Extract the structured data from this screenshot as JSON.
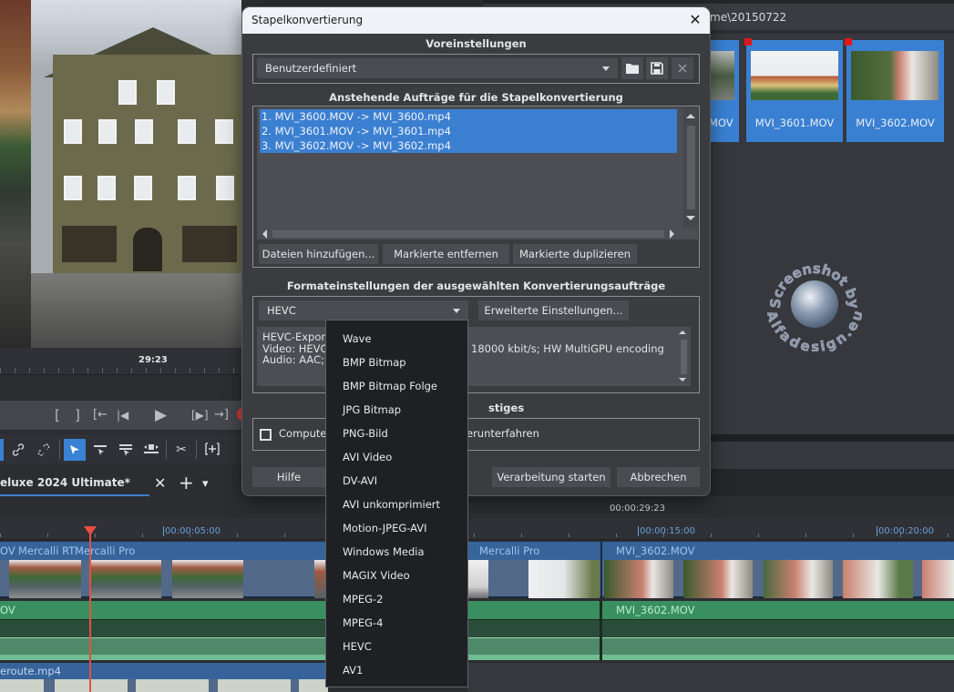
{
  "dialog": {
    "title": "Stapelkonvertierung",
    "sections": {
      "presets": "Voreinstellungen",
      "pending_jobs": "Anstehende Aufträge für die Stapelkonvertierung",
      "format_settings": "Formateinstellungen der ausgewählten Konvertierungsaufträge",
      "misc": "stiges"
    },
    "preset_value": "Benutzerdefiniert",
    "jobs": [
      "1. MVI_3600.MOV -> MVI_3600.mp4",
      "2. MVI_3601.MOV -> MVI_3601.mp4",
      "3. MVI_3602.MOV -> MVI_3602.mp4"
    ],
    "buttons": {
      "add_files": "Dateien hinzufügen...",
      "remove_marked": "Markierte entfernen",
      "duplicate_marked": "Markierte duplizieren",
      "advanced_settings": "Erweiterte Einstellungen...",
      "help": "Hilfe",
      "start": "Verarbeitung starten",
      "cancel": "Abbrechen"
    },
    "format_value": "HEVC",
    "info_lines": {
      "line1_left": "HEVC-Export",
      "line2_left": "Video: HEVC;",
      "line2_right": "18000 kbit/s; HW MultiGPU encoding",
      "line3_left": "Audio: AAC; S"
    },
    "shutdown_label_left": "Computer",
    "shutdown_label_right": "erunterfahren",
    "shutdown_checked": false,
    "format_options": [
      "Wave",
      "BMP Bitmap",
      "BMP Bitmap Folge",
      "JPG Bitmap",
      "PNG-Bild",
      "AVI Video",
      "DV-AVI",
      "AVI unkomprimiert",
      "Motion-JPEG-AVI",
      "Windows Media",
      "MAGIX Video",
      "MPEG-2",
      "MPEG-4",
      "HEVC",
      "AV1"
    ],
    "close_glyph": "✕"
  },
  "preview": {
    "timecode": "29:23"
  },
  "transport": {
    "mark_in": "[",
    "mark_out": "]",
    "goto_in": "[←",
    "prev": "|◀",
    "play": "▶",
    "goto_marker": "[▶]",
    "goto_out": "→]"
  },
  "project": {
    "tab_label": "eluxe 2024 Ultimate*",
    "close_glyph": "✕",
    "add_glyph": "+",
    "menu_glyph": "▾"
  },
  "browser": {
    "path": "me\\20150722",
    "thumbnails": [
      {
        "label": "MOV",
        "flagged": false
      },
      {
        "label": "MVI_3601.MOV",
        "flagged": true
      },
      {
        "label": "MVI_3602.MOV",
        "flagged": true
      }
    ]
  },
  "watermark": {
    "top_text": "Screenshot by",
    "bottom_text": "Alfadesign.eu"
  },
  "timeline": {
    "current_timecode": "00:00:29:23",
    "ruler_marks": [
      "00:00:05:00",
      "00:00:15:00",
      "00:00:20:00"
    ],
    "video_clip_labels": [
      "OV",
      "Mercalli RT",
      "Mercalli Pro",
      "Mercalli Pro",
      "MVI_3602.MOV"
    ],
    "audio_clip_labels": [
      "OV",
      "MVI_3602.MOV"
    ],
    "bottom_clip_label": "eroute.mp4"
  },
  "colors": {
    "accent": "#3b7fd1",
    "video_track": "#36649a",
    "audio_track": "#3a8f60",
    "playhead": "#e45040",
    "flag": "#e01818"
  }
}
